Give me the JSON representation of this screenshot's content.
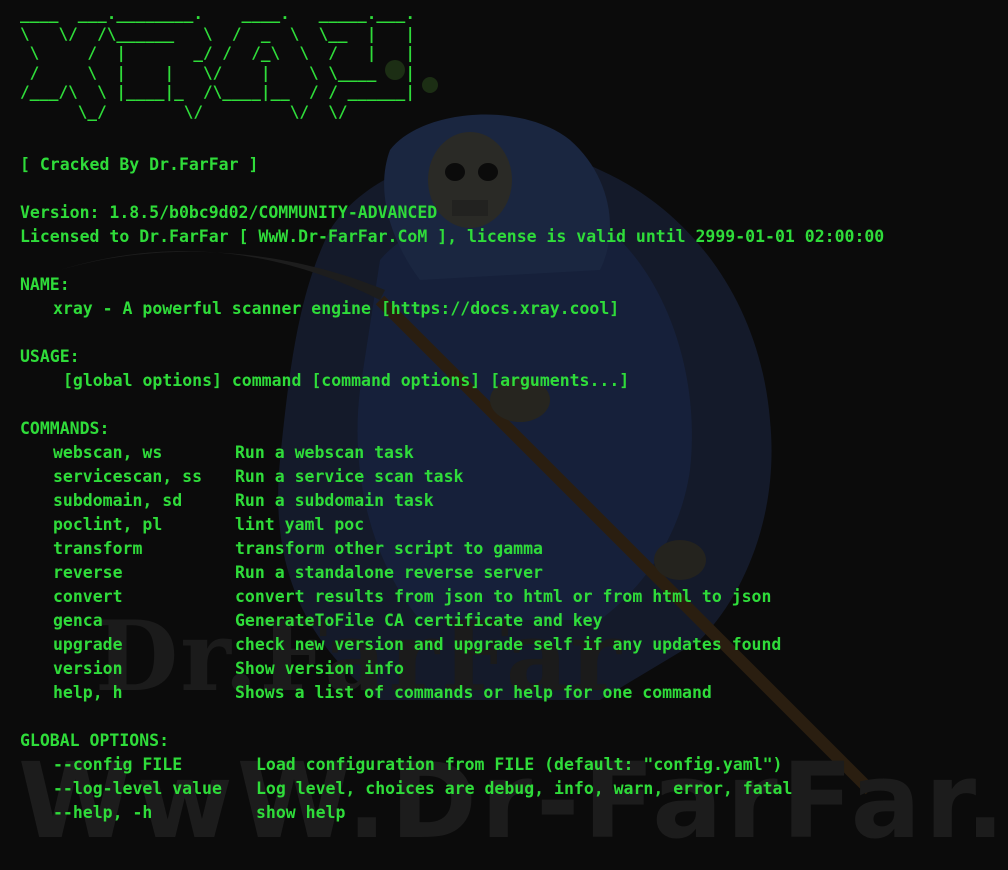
{
  "banner": {
    "ascii_logo": "____  ___.________.    ____.   _____.___.\n\\   \\/  /\\______   \\  /  _  \\  \\__  |   |\n \\     /  |       _/ /  /_\\  \\  /   |   |\n /     \\  |    |   \\/    |    \\ \\____   |\n/___/\\  \\ |____|_  /\\____|__  / / ______|\n      \\_/        \\/         \\/  \\/"
  },
  "crack_note": "[ Cracked By Dr.FarFar ]",
  "version_line": "Version: 1.8.5/b0bc9d02/COMMUNITY-ADVANCED",
  "license_line": "Licensed to Dr.FarFar [ WwW.Dr-FarFar.CoM ], license is valid until 2999-01-01 02:00:00",
  "name_section": {
    "heading": "NAME:",
    "text": "xray - A powerful scanner engine [https://docs.xray.cool]"
  },
  "usage_section": {
    "heading": "USAGE:",
    "text": "[global options] command [command options] [arguments...]"
  },
  "commands_section": {
    "heading": "COMMANDS:",
    "items": [
      {
        "name": "webscan, ws",
        "desc": "Run a webscan task"
      },
      {
        "name": "servicescan, ss",
        "desc": "Run a service scan task"
      },
      {
        "name": "subdomain, sd",
        "desc": "Run a subdomain task"
      },
      {
        "name": "poclint, pl",
        "desc": "lint yaml poc"
      },
      {
        "name": "transform",
        "desc": "transform other script to gamma"
      },
      {
        "name": "reverse",
        "desc": "Run a standalone reverse server"
      },
      {
        "name": "convert",
        "desc": "convert results from json to html or from html to json"
      },
      {
        "name": "genca",
        "desc": "GenerateToFile CA certificate and key"
      },
      {
        "name": "upgrade",
        "desc": "check new version and upgrade self if any updates found"
      },
      {
        "name": "version",
        "desc": "Show version info"
      },
      {
        "name": "help, h",
        "desc": "Shows a list of commands or help for one command"
      }
    ]
  },
  "global_options_section": {
    "heading": "GLOBAL OPTIONS:",
    "items": [
      {
        "name": "--config FILE",
        "desc": "Load configuration from FILE (default: \"config.yaml\")"
      },
      {
        "name": "--log-level value",
        "desc": "Log level, choices are debug, info, warn, error, fatal"
      },
      {
        "name": "--help, -h",
        "desc": "show help"
      }
    ]
  },
  "watermark": {
    "top": "Dr.FarFar",
    "bottom": "WwW.Dr-FarFar.CoM"
  },
  "colors": {
    "text": "#2fdc3a",
    "background": "#0b0b0b"
  }
}
